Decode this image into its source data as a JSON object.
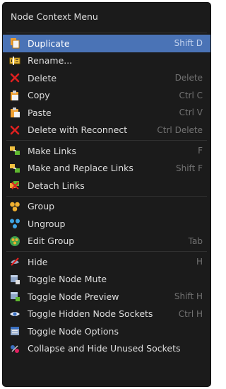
{
  "menu": {
    "title": "Node Context Menu",
    "groups": [
      [
        {
          "label": "Duplicate",
          "shortcut": "Shift D",
          "icon": "duplicate-icon",
          "active": true
        },
        {
          "label": "Rename...",
          "shortcut": "",
          "icon": "rename-icon"
        },
        {
          "label": "Delete",
          "shortcut": "Delete",
          "icon": "x-icon"
        },
        {
          "label": "Copy",
          "shortcut": "Ctrl C",
          "icon": "copy-icon"
        },
        {
          "label": "Paste",
          "shortcut": "Ctrl V",
          "icon": "paste-icon"
        },
        {
          "label": "Delete with Reconnect",
          "shortcut": "Ctrl Delete",
          "icon": "x-icon"
        }
      ],
      [
        {
          "label": "Make Links",
          "shortcut": "F",
          "icon": "make-links-icon"
        },
        {
          "label": "Make and Replace Links",
          "shortcut": "Shift F",
          "icon": "make-links-icon"
        },
        {
          "label": "Detach Links",
          "shortcut": "",
          "icon": "detach-links-icon"
        }
      ],
      [
        {
          "label": "Group",
          "shortcut": "",
          "icon": "group-icon"
        },
        {
          "label": "Ungroup",
          "shortcut": "",
          "icon": "ungroup-icon"
        },
        {
          "label": "Edit Group",
          "shortcut": "Tab",
          "icon": "edit-group-icon"
        }
      ],
      [
        {
          "label": "Hide",
          "shortcut": "H",
          "icon": "hide-icon"
        },
        {
          "label": "Toggle Node Mute",
          "shortcut": "",
          "icon": "mute-node-icon"
        },
        {
          "label": "Toggle Node Preview",
          "shortcut": "Shift H",
          "icon": "preview-node-icon"
        },
        {
          "label": "Toggle Hidden Node Sockets",
          "shortcut": "Ctrl H",
          "icon": "eye-icon"
        },
        {
          "label": "Toggle Node Options",
          "shortcut": "",
          "icon": "node-options-icon"
        },
        {
          "label": "Collapse and Hide Unused Sockets",
          "shortcut": "",
          "icon": "collapse-sockets-icon"
        }
      ]
    ]
  },
  "colors": {
    "background": "#1b1b1b",
    "highlight": "#4a73b6",
    "text": "#dedede",
    "shortcut": "#727272",
    "delete_red": "#e02020"
  }
}
